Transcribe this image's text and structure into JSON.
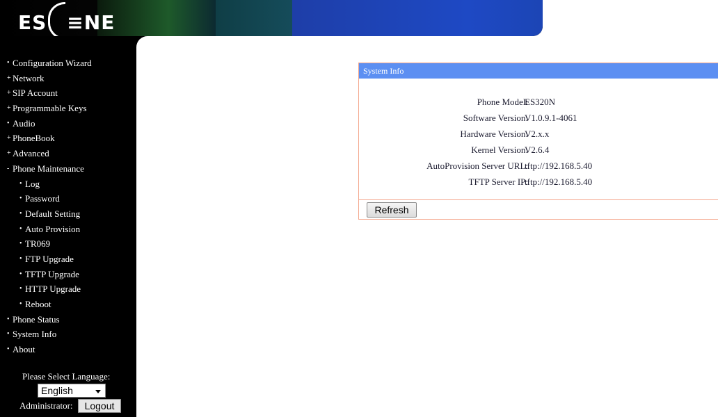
{
  "header": {
    "logo_text_left": "ES",
    "logo_text_right": "NE",
    "logo_middle": "≡"
  },
  "sidebar": {
    "items": [
      {
        "label": "Configuration Wizard",
        "bullet": "•",
        "level": 0
      },
      {
        "label": "Network",
        "bullet": "+",
        "level": 0
      },
      {
        "label": "SIP Account",
        "bullet": "+",
        "level": 0
      },
      {
        "label": "Programmable Keys",
        "bullet": "+",
        "level": 0
      },
      {
        "label": "Audio",
        "bullet": "•",
        "level": 0
      },
      {
        "label": "PhoneBook",
        "bullet": "+",
        "level": 0
      },
      {
        "label": "Advanced",
        "bullet": "+",
        "level": 0
      },
      {
        "label": "Phone Maintenance",
        "bullet": "-",
        "level": 0
      },
      {
        "label": "Log",
        "bullet": "•",
        "level": 1
      },
      {
        "label": "Password",
        "bullet": "•",
        "level": 1
      },
      {
        "label": "Default Setting",
        "bullet": "•",
        "level": 1
      },
      {
        "label": "Auto Provision",
        "bullet": "•",
        "level": 1
      },
      {
        "label": "TR069",
        "bullet": "•",
        "level": 1
      },
      {
        "label": "FTP Upgrade",
        "bullet": "•",
        "level": 1
      },
      {
        "label": "TFTP Upgrade",
        "bullet": "•",
        "level": 1
      },
      {
        "label": "HTTP Upgrade",
        "bullet": "•",
        "level": 1
      },
      {
        "label": "Reboot",
        "bullet": "•",
        "level": 1
      },
      {
        "label": "Phone Status",
        "bullet": "•",
        "level": 0
      },
      {
        "label": "System Info",
        "bullet": "•",
        "level": 0
      },
      {
        "label": "About",
        "bullet": "•",
        "level": 0
      }
    ],
    "language_label": "Please Select Language:",
    "language_value": "English",
    "admin_label": "Administrator:",
    "logout_label": "Logout"
  },
  "panel": {
    "title": "System Info",
    "rows": [
      {
        "label": "Phone Model:",
        "value": "ES320N"
      },
      {
        "label": "Software Version:",
        "value": "V1.0.9.1-4061"
      },
      {
        "label": "Hardware Version:",
        "value": "V2.x.x"
      },
      {
        "label": "Kernel Version:",
        "value": "V2.6.4"
      },
      {
        "label": "AutoProvision Server URL:",
        "value": "tftp://192.168.5.40"
      },
      {
        "label": "TFTP Server IP:",
        "value": "tftp://192.168.5.40"
      }
    ],
    "refresh_label": "Refresh"
  },
  "colors": {
    "panel_title_bg": "#5c8ff2",
    "panel_border": "#f4a58a",
    "header_blue": "#1e49c4",
    "sidebar_bg": "#000000"
  }
}
